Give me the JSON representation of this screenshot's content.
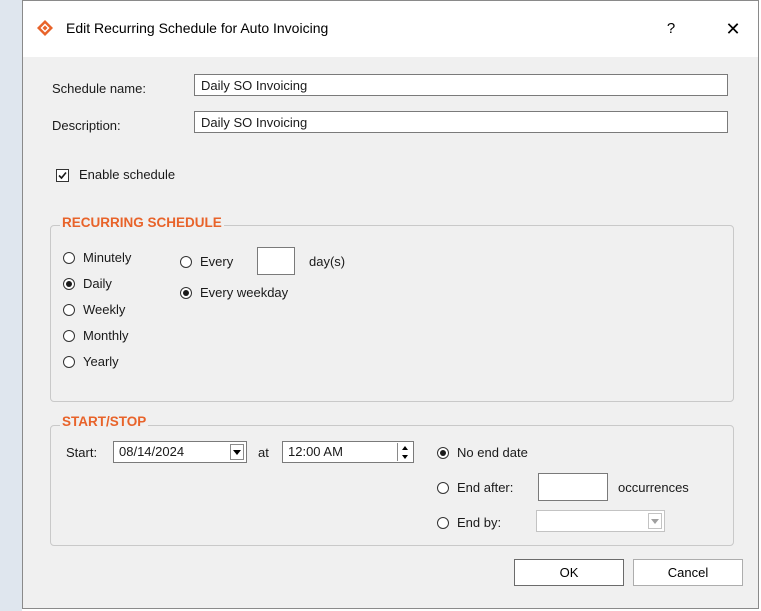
{
  "dialog": {
    "title": "Edit Recurring Schedule for Auto Invoicing",
    "help_label": "?",
    "close_label": "✕"
  },
  "form": {
    "schedule_name_label": "Schedule name:",
    "schedule_name_value": "Daily SO Invoicing",
    "description_label": "Description:",
    "description_value": "Daily SO Invoicing",
    "enable_schedule_label": "Enable schedule",
    "enable_schedule_checked": true
  },
  "recurring": {
    "title": "RECURRING SCHEDULE",
    "frequencies": [
      {
        "label": "Minutely",
        "selected": false
      },
      {
        "label": "Daily",
        "selected": true
      },
      {
        "label": "Weekly",
        "selected": false
      },
      {
        "label": "Monthly",
        "selected": false
      },
      {
        "label": "Yearly",
        "selected": false
      }
    ],
    "every_label": "Every",
    "every_value": "",
    "days_suffix": "day(s)",
    "every_weekday_label": "Every weekday",
    "every_n_days_selected": false,
    "every_weekday_selected": true
  },
  "startstop": {
    "title": "START/STOP",
    "start_label": "Start:",
    "start_date": "08/14/2024",
    "at_label": "at",
    "start_time": "12:00 AM",
    "no_end_date_label": "No end date",
    "no_end_date_selected": true,
    "end_after_label": "End after:",
    "end_after_value": "",
    "occurrences_label": "occurrences",
    "end_by_label": "End by:",
    "end_by_value": ""
  },
  "buttons": {
    "ok_label": "OK",
    "cancel_label": "Cancel"
  },
  "colors": {
    "accent_orange": "#e8632a",
    "dialog_bg": "#f0f0f0",
    "title_bg": "#ffffff"
  }
}
